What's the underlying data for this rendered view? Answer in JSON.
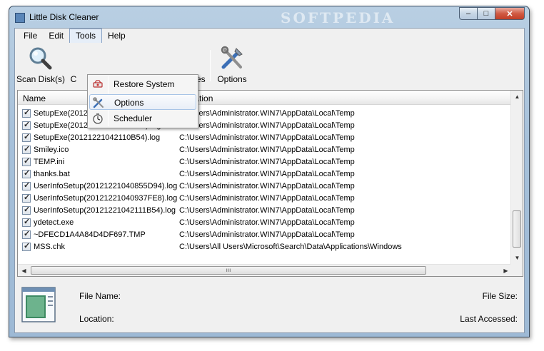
{
  "window": {
    "title": "Little Disk Cleaner",
    "watermark": "SOFTPEDIA",
    "controls": {
      "minimize": "–",
      "maximize": "□",
      "close": "✕"
    }
  },
  "menubar": [
    "File",
    "Edit",
    "Tools",
    "Help"
  ],
  "toolbar": {
    "scan_label": "Scan Disk(s)",
    "second_label_partial": "C",
    "properties_label_partial": "erties",
    "options_label": "Options"
  },
  "tools_menu": {
    "items": [
      {
        "label": "Restore System",
        "icon": "restore-system-icon"
      },
      {
        "label": "Options",
        "icon": "wrench-screwdriver-icon"
      },
      {
        "label": "Scheduler",
        "icon": "clock-icon"
      }
    ]
  },
  "file_list": {
    "columns": [
      "Name",
      "Location"
    ],
    "rows": [
      {
        "name": "SetupExe(20121221040852D94).log",
        "location": "C:\\Users\\Administrator.WIN7\\AppData\\Local\\Temp",
        "checked": true
      },
      {
        "name": "SetupExe(20121221040934FE8).log",
        "location": "C:\\Users\\Administrator.WIN7\\AppData\\Local\\Temp",
        "checked": true
      },
      {
        "name": "SetupExe(20121221042110B54).log",
        "location": "C:\\Users\\Administrator.WIN7\\AppData\\Local\\Temp",
        "checked": true
      },
      {
        "name": "Smiley.ico",
        "location": "C:\\Users\\Administrator.WIN7\\AppData\\Local\\Temp",
        "checked": true
      },
      {
        "name": "TEMP.ini",
        "location": "C:\\Users\\Administrator.WIN7\\AppData\\Local\\Temp",
        "checked": true
      },
      {
        "name": "thanks.bat",
        "location": "C:\\Users\\Administrator.WIN7\\AppData\\Local\\Temp",
        "checked": true
      },
      {
        "name": "UserInfoSetup(20121221040855D94).log",
        "location": "C:\\Users\\Administrator.WIN7\\AppData\\Local\\Temp",
        "checked": true
      },
      {
        "name": "UserInfoSetup(20121221040937FE8).log",
        "location": "C:\\Users\\Administrator.WIN7\\AppData\\Local\\Temp",
        "checked": true
      },
      {
        "name": "UserInfoSetup(20121221042111B54).log",
        "location": "C:\\Users\\Administrator.WIN7\\AppData\\Local\\Temp",
        "checked": true
      },
      {
        "name": "ydetect.exe",
        "location": "C:\\Users\\Administrator.WIN7\\AppData\\Local\\Temp",
        "checked": true
      },
      {
        "name": "~DFECD1A4A84D4DF697.TMP",
        "location": "C:\\Users\\Administrator.WIN7\\AppData\\Local\\Temp",
        "checked": true
      },
      {
        "name": "MSS.chk",
        "location": "C:\\Users\\All Users\\Microsoft\\Search\\Data\\Applications\\Windows",
        "checked": true
      }
    ]
  },
  "details": {
    "file_name_label": "File Name:",
    "file_size_label": "File Size:",
    "location_label": "Location:",
    "last_accessed_label": "Last Accessed:"
  }
}
